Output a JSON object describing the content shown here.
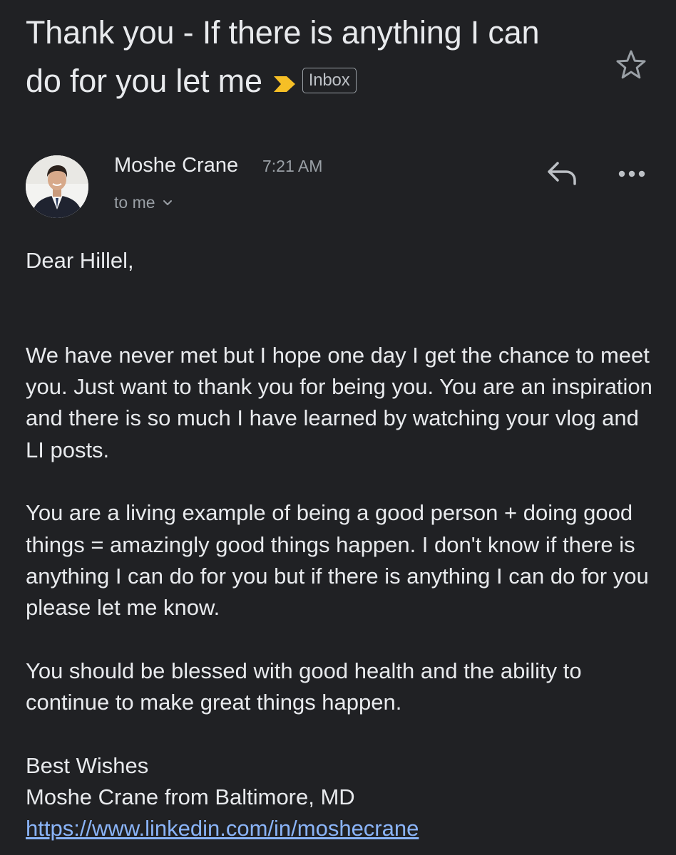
{
  "email": {
    "subject": "Thank you - If there is anything I can do for you let me",
    "label": "Inbox",
    "sender": {
      "name": "Moshe Crane",
      "time": "7:21 AM",
      "recipients": "to me"
    },
    "body": {
      "greeting": "Dear Hillel,",
      "paragraphs": [
        "We have never met but I hope one day I get the chance to meet you. Just want to thank you for being you. You are an inspiration and there is so much I have learned by watching your vlog and LI posts.",
        "You are a living example of being a good person + doing good things = amazingly good things happen. I don't know if there is anything I can do for you but if there is anything I can do for you please let me know.",
        "You should be blessed with good health and the ability to continue to make great things happen."
      ],
      "closing": "Best Wishes",
      "signature": "Moshe Crane from Baltimore, MD",
      "link": "https://www.linkedin.com/in/moshecrane"
    }
  },
  "icons": {
    "importance": "importance-marker-icon",
    "star": "star-icon",
    "reply": "reply-icon",
    "more": "more-options-icon",
    "expand": "chevron-down-icon"
  },
  "colors": {
    "background": "#202124",
    "text": "#e8eaed",
    "secondary_text": "#9aa0a6",
    "importance": "#f6bf26",
    "link": "#8ab4f8"
  }
}
